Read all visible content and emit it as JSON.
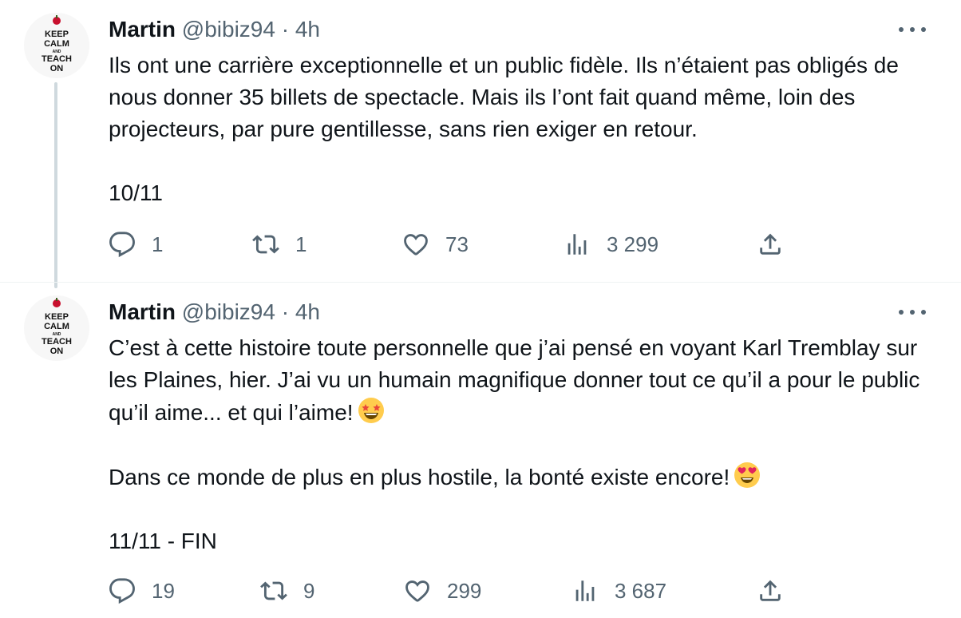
{
  "colors": {
    "text": "#0f1419",
    "secondary": "#536471",
    "divider": "#eff3f4",
    "thread": "#cfd9de",
    "avatar_red": "#c8102e"
  },
  "avatar": {
    "lines": [
      "KEEP",
      "CALM",
      "AND",
      "TEACH",
      "ON"
    ]
  },
  "tweets": [
    {
      "name": "Martin",
      "handle": "@bibiz94",
      "sep": "·",
      "time": "4h",
      "paragraphs": [
        "Ils ont une carrière exceptionnelle et un public fidèle. Ils n’étaient pas obligés de nous donner 35 billets de spectacle. Mais ils l’ont fait quand même, loin des projecteurs, par pure gentillesse, sans rien exiger en retour.",
        "10/11"
      ],
      "replies": "1",
      "retweets": "1",
      "likes": "73",
      "views": "3 299"
    },
    {
      "name": "Martin",
      "handle": "@bibiz94",
      "sep": "·",
      "time": "4h",
      "paragraphs": [
        "C’est à cette histoire toute personnelle que j’ai pensé en voyant Karl Tremblay sur les Plaines, hier. J’ai vu un humain magnifique donner tout ce qu’il a pour le public qu’il aime... et qui l’aime!",
        "Dans ce monde de plus en plus hostile, la bonté existe encore!",
        "11/11 - FIN"
      ],
      "emojis": [
        "star-struck-emoji",
        "heart-eyes-emoji"
      ],
      "replies": "19",
      "retweets": "9",
      "likes": "299",
      "views": "3 687"
    }
  ]
}
